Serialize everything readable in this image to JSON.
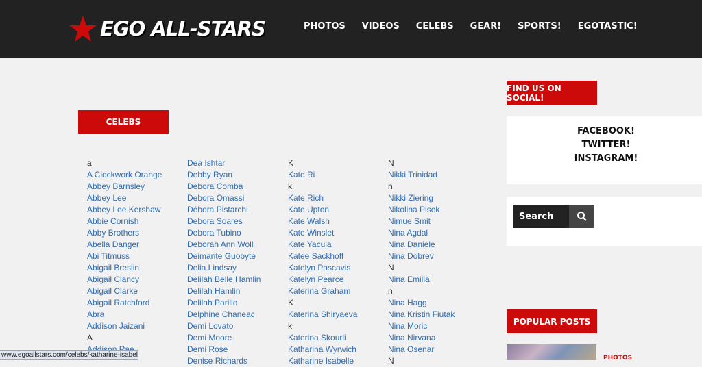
{
  "brand": {
    "name": "EGO ALL-STARS",
    "accent": "#cc0a0a",
    "header_bg": "#222222"
  },
  "nav": [
    "PHOTOS",
    "VIDEOS",
    "CELEBS",
    "GEAR!",
    "SPORTS!",
    "EGOTASTIC!"
  ],
  "main": {
    "section_title": "CELEBS"
  },
  "columns": [
    [
      {
        "t": "a",
        "k": "letter"
      },
      {
        "t": "A Clockwork Orange",
        "k": "link"
      },
      {
        "t": "Abbey Barnsley",
        "k": "link"
      },
      {
        "t": "Abbey Lee",
        "k": "link"
      },
      {
        "t": "Abbey Lee Kershaw",
        "k": "link"
      },
      {
        "t": "Abbie Cornish",
        "k": "link"
      },
      {
        "t": "Abby Brothers",
        "k": "link"
      },
      {
        "t": "Abella Danger",
        "k": "link"
      },
      {
        "t": "Abi Titmuss",
        "k": "link"
      },
      {
        "t": "Abigail Breslin",
        "k": "link"
      },
      {
        "t": "Abigail Clancy",
        "k": "link"
      },
      {
        "t": "Abigail Clarke",
        "k": "link"
      },
      {
        "t": "Abigail Ratchford",
        "k": "link"
      },
      {
        "t": "Abra",
        "k": "link"
      },
      {
        "t": "Addison Jaizani",
        "k": "link"
      },
      {
        "t": "A",
        "k": "letter"
      },
      {
        "t": "Addison Rae",
        "k": "link"
      }
    ],
    [
      {
        "t": "Dea Ishtar",
        "k": "link"
      },
      {
        "t": "Debby Ryan",
        "k": "link"
      },
      {
        "t": "Debora Comba",
        "k": "link"
      },
      {
        "t": "Debora Omassi",
        "k": "link"
      },
      {
        "t": "Débora Pistarchi",
        "k": "link"
      },
      {
        "t": "Debora Soares",
        "k": "link"
      },
      {
        "t": "Debora Tubino",
        "k": "link"
      },
      {
        "t": "Deborah Ann Woll",
        "k": "link"
      },
      {
        "t": "Deimante Guobyte",
        "k": "link"
      },
      {
        "t": "Delia Lindsay",
        "k": "link"
      },
      {
        "t": "Delilah Belle Hamlin",
        "k": "link"
      },
      {
        "t": "Delilah Hamlin",
        "k": "link"
      },
      {
        "t": "Delilah Parillo",
        "k": "link"
      },
      {
        "t": "Delphine Chaneac",
        "k": "link"
      },
      {
        "t": "Demi Lovato",
        "k": "link"
      },
      {
        "t": "Demi Moore",
        "k": "link"
      },
      {
        "t": "Demi Rose",
        "k": "link"
      },
      {
        "t": "Denise Richards",
        "k": "link"
      }
    ],
    [
      {
        "t": "K",
        "k": "letter"
      },
      {
        "t": "Kate Ri",
        "k": "link"
      },
      {
        "t": "k",
        "k": "letter"
      },
      {
        "t": "Kate Rich",
        "k": "link"
      },
      {
        "t": "Kate Upton",
        "k": "link"
      },
      {
        "t": "Kate Walsh",
        "k": "link"
      },
      {
        "t": "Kate Winslet",
        "k": "link"
      },
      {
        "t": "Kate Yacula",
        "k": "link"
      },
      {
        "t": "Katee Sackhoff",
        "k": "link"
      },
      {
        "t": "Katelyn Pascavis",
        "k": "link"
      },
      {
        "t": "Katelyn Pearce",
        "k": "link"
      },
      {
        "t": "Katerina Graham",
        "k": "link"
      },
      {
        "t": "K",
        "k": "letter"
      },
      {
        "t": "Katerina Shiryaeva",
        "k": "link"
      },
      {
        "t": "k",
        "k": "letter"
      },
      {
        "t": "Katerina Skourli",
        "k": "link"
      },
      {
        "t": "Katharina Wyrwich",
        "k": "link"
      },
      {
        "t": "Katharine Isabelle",
        "k": "link"
      }
    ],
    [
      {
        "t": "N",
        "k": "letter"
      },
      {
        "t": "Nikki Trinidad",
        "k": "link"
      },
      {
        "t": "n",
        "k": "letter"
      },
      {
        "t": "Nikki Ziering",
        "k": "link"
      },
      {
        "t": "Nikolina Pisek",
        "k": "link"
      },
      {
        "t": "Nimue Smit",
        "k": "link"
      },
      {
        "t": "Nina Agdal",
        "k": "link"
      },
      {
        "t": "Nina Daniele",
        "k": "link"
      },
      {
        "t": "Nina Dobrev",
        "k": "link"
      },
      {
        "t": "N",
        "k": "letter"
      },
      {
        "t": "Nina Emilia",
        "k": "link"
      },
      {
        "t": "n",
        "k": "letter"
      },
      {
        "t": "Nina Hagg",
        "k": "link"
      },
      {
        "t": "Nina Kristin Fiutak",
        "k": "link"
      },
      {
        "t": "Nina Moric",
        "k": "link"
      },
      {
        "t": "Nina Nirvana",
        "k": "link"
      },
      {
        "t": "Nina Osenar",
        "k": "link"
      },
      {
        "t": "N",
        "k": "letter"
      }
    ]
  ],
  "sidebar": {
    "social_title": "FIND US ON SOCIAL!",
    "social_links": [
      "FACEBOOK!",
      "TWITTER!",
      "INSTAGRAM!"
    ],
    "search_placeholder": "Search",
    "popular_title": "POPULAR POSTS",
    "popular_tag": "PHOTOS"
  },
  "status_url": "www.egoallstars.com/celebs/katharine-isabelle"
}
